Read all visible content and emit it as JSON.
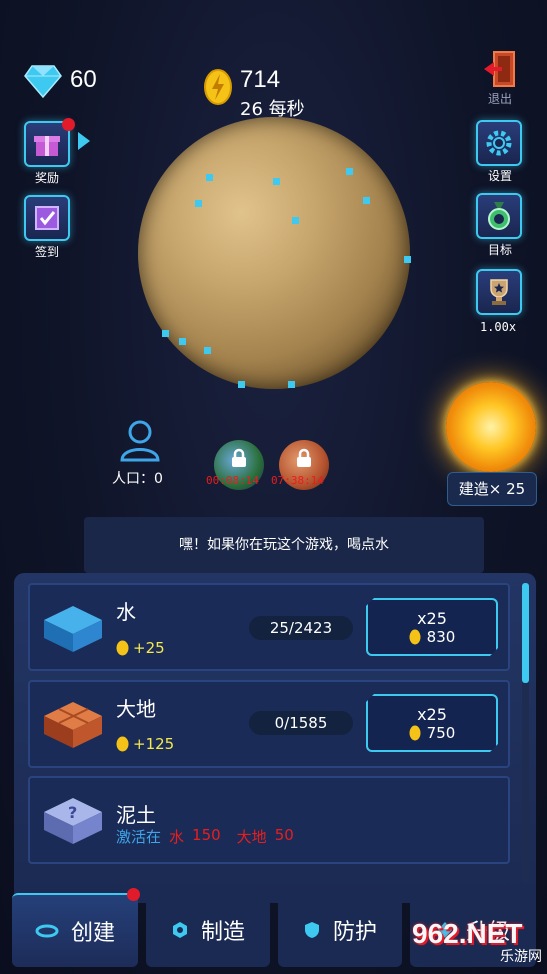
{
  "hud": {
    "gems": "60",
    "coins": "714",
    "rate": "26 每秒",
    "exit_label": "退出"
  },
  "left_menu": [
    {
      "label": "奖励",
      "icon": "gift-icon"
    },
    {
      "label": "签到",
      "icon": "checkin-icon"
    }
  ],
  "right_menu": [
    {
      "label": "设置",
      "icon": "gear-icon"
    },
    {
      "label": "目标",
      "icon": "medal-icon"
    },
    {
      "label": "1.00x",
      "icon": "trophy-icon"
    }
  ],
  "population": "人口：0",
  "locked_planets": [
    {
      "timer": "00:08:14",
      "color": "earth"
    },
    {
      "timer": "07:38:14",
      "color": "mars"
    }
  ],
  "build": {
    "label": "建造",
    "count": "× 25"
  },
  "tip": "嘿！如果你在玩这个游戏，喝点水",
  "resources": [
    {
      "name": "水",
      "income": "+25",
      "progress": "25/2423",
      "mult": "x25",
      "cost": "830"
    },
    {
      "name": "大地",
      "income": "+125",
      "progress": "0/1585",
      "mult": "x25",
      "cost": "750"
    },
    {
      "name": "泥土",
      "activate_label": "激活在",
      "req1_name": "水",
      "req1_val": "150",
      "req2_name": "大地",
      "req2_val": "50"
    }
  ],
  "nav": [
    {
      "label": "创建"
    },
    {
      "label": "制造"
    },
    {
      "label": "防护"
    },
    {
      "label": "升级"
    }
  ],
  "colors": {
    "accent": "#3ec9f1",
    "coin": "#f5ea4c",
    "alert": "#e11b2a"
  },
  "watermark": {
    "brand": "962.NET",
    "sub": "乐游网"
  }
}
